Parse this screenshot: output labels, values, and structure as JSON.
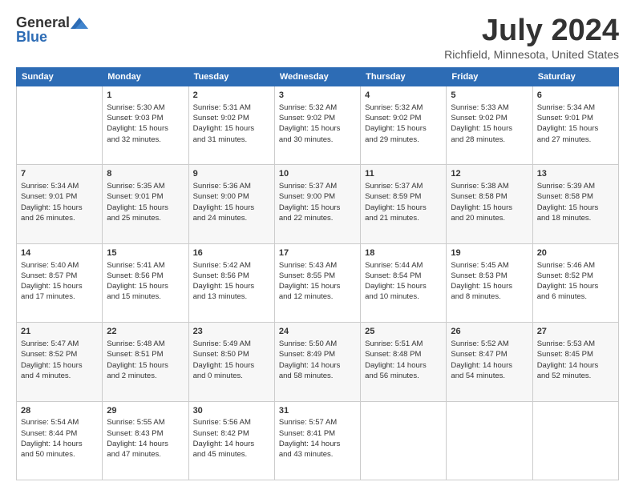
{
  "header": {
    "logo_general": "General",
    "logo_blue": "Blue",
    "month_title": "July 2024",
    "location": "Richfield, Minnesota, United States"
  },
  "weekdays": [
    "Sunday",
    "Monday",
    "Tuesday",
    "Wednesday",
    "Thursday",
    "Friday",
    "Saturday"
  ],
  "weeks": [
    [
      {
        "day": "",
        "info": ""
      },
      {
        "day": "1",
        "info": "Sunrise: 5:30 AM\nSunset: 9:03 PM\nDaylight: 15 hours\nand 32 minutes."
      },
      {
        "day": "2",
        "info": "Sunrise: 5:31 AM\nSunset: 9:02 PM\nDaylight: 15 hours\nand 31 minutes."
      },
      {
        "day": "3",
        "info": "Sunrise: 5:32 AM\nSunset: 9:02 PM\nDaylight: 15 hours\nand 30 minutes."
      },
      {
        "day": "4",
        "info": "Sunrise: 5:32 AM\nSunset: 9:02 PM\nDaylight: 15 hours\nand 29 minutes."
      },
      {
        "day": "5",
        "info": "Sunrise: 5:33 AM\nSunset: 9:02 PM\nDaylight: 15 hours\nand 28 minutes."
      },
      {
        "day": "6",
        "info": "Sunrise: 5:34 AM\nSunset: 9:01 PM\nDaylight: 15 hours\nand 27 minutes."
      }
    ],
    [
      {
        "day": "7",
        "info": "Sunrise: 5:34 AM\nSunset: 9:01 PM\nDaylight: 15 hours\nand 26 minutes."
      },
      {
        "day": "8",
        "info": "Sunrise: 5:35 AM\nSunset: 9:01 PM\nDaylight: 15 hours\nand 25 minutes."
      },
      {
        "day": "9",
        "info": "Sunrise: 5:36 AM\nSunset: 9:00 PM\nDaylight: 15 hours\nand 24 minutes."
      },
      {
        "day": "10",
        "info": "Sunrise: 5:37 AM\nSunset: 9:00 PM\nDaylight: 15 hours\nand 22 minutes."
      },
      {
        "day": "11",
        "info": "Sunrise: 5:37 AM\nSunset: 8:59 PM\nDaylight: 15 hours\nand 21 minutes."
      },
      {
        "day": "12",
        "info": "Sunrise: 5:38 AM\nSunset: 8:58 PM\nDaylight: 15 hours\nand 20 minutes."
      },
      {
        "day": "13",
        "info": "Sunrise: 5:39 AM\nSunset: 8:58 PM\nDaylight: 15 hours\nand 18 minutes."
      }
    ],
    [
      {
        "day": "14",
        "info": "Sunrise: 5:40 AM\nSunset: 8:57 PM\nDaylight: 15 hours\nand 17 minutes."
      },
      {
        "day": "15",
        "info": "Sunrise: 5:41 AM\nSunset: 8:56 PM\nDaylight: 15 hours\nand 15 minutes."
      },
      {
        "day": "16",
        "info": "Sunrise: 5:42 AM\nSunset: 8:56 PM\nDaylight: 15 hours\nand 13 minutes."
      },
      {
        "day": "17",
        "info": "Sunrise: 5:43 AM\nSunset: 8:55 PM\nDaylight: 15 hours\nand 12 minutes."
      },
      {
        "day": "18",
        "info": "Sunrise: 5:44 AM\nSunset: 8:54 PM\nDaylight: 15 hours\nand 10 minutes."
      },
      {
        "day": "19",
        "info": "Sunrise: 5:45 AM\nSunset: 8:53 PM\nDaylight: 15 hours\nand 8 minutes."
      },
      {
        "day": "20",
        "info": "Sunrise: 5:46 AM\nSunset: 8:52 PM\nDaylight: 15 hours\nand 6 minutes."
      }
    ],
    [
      {
        "day": "21",
        "info": "Sunrise: 5:47 AM\nSunset: 8:52 PM\nDaylight: 15 hours\nand 4 minutes."
      },
      {
        "day": "22",
        "info": "Sunrise: 5:48 AM\nSunset: 8:51 PM\nDaylight: 15 hours\nand 2 minutes."
      },
      {
        "day": "23",
        "info": "Sunrise: 5:49 AM\nSunset: 8:50 PM\nDaylight: 15 hours\nand 0 minutes."
      },
      {
        "day": "24",
        "info": "Sunrise: 5:50 AM\nSunset: 8:49 PM\nDaylight: 14 hours\nand 58 minutes."
      },
      {
        "day": "25",
        "info": "Sunrise: 5:51 AM\nSunset: 8:48 PM\nDaylight: 14 hours\nand 56 minutes."
      },
      {
        "day": "26",
        "info": "Sunrise: 5:52 AM\nSunset: 8:47 PM\nDaylight: 14 hours\nand 54 minutes."
      },
      {
        "day": "27",
        "info": "Sunrise: 5:53 AM\nSunset: 8:45 PM\nDaylight: 14 hours\nand 52 minutes."
      }
    ],
    [
      {
        "day": "28",
        "info": "Sunrise: 5:54 AM\nSunset: 8:44 PM\nDaylight: 14 hours\nand 50 minutes."
      },
      {
        "day": "29",
        "info": "Sunrise: 5:55 AM\nSunset: 8:43 PM\nDaylight: 14 hours\nand 47 minutes."
      },
      {
        "day": "30",
        "info": "Sunrise: 5:56 AM\nSunset: 8:42 PM\nDaylight: 14 hours\nand 45 minutes."
      },
      {
        "day": "31",
        "info": "Sunrise: 5:57 AM\nSunset: 8:41 PM\nDaylight: 14 hours\nand 43 minutes."
      },
      {
        "day": "",
        "info": ""
      },
      {
        "day": "",
        "info": ""
      },
      {
        "day": "",
        "info": ""
      }
    ]
  ]
}
